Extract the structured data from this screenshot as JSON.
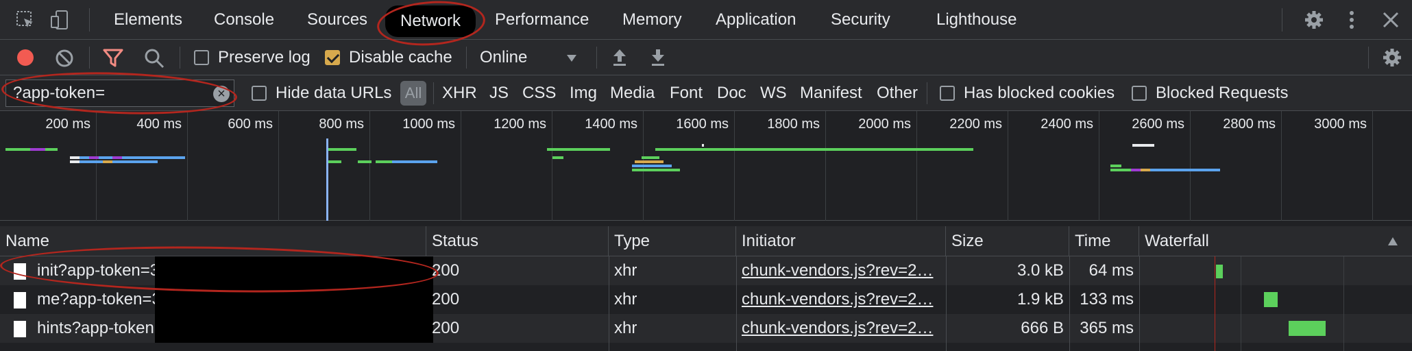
{
  "tabs": [
    "Elements",
    "Console",
    "Sources",
    "Network",
    "Performance",
    "Memory",
    "Application",
    "Security",
    "Lighthouse"
  ],
  "active_tab": "Network",
  "toolbar": {
    "preserve_log": "Preserve log",
    "disable_cache": "Disable cache",
    "throttling": "Online"
  },
  "filter": {
    "value": "?app-token=",
    "hide_data_urls": "Hide data URLs",
    "all": "All",
    "types": [
      "XHR",
      "JS",
      "CSS",
      "Img",
      "Media",
      "Font",
      "Doc",
      "WS",
      "Manifest",
      "Other"
    ],
    "has_blocked_cookies": "Has blocked cookies",
    "blocked_requests": "Blocked Requests"
  },
  "overview_ticks": [
    "200 ms",
    "400 ms",
    "600 ms",
    "800 ms",
    "1000 ms",
    "1200 ms",
    "1400 ms",
    "1600 ms",
    "1800 ms",
    "2000 ms",
    "2200 ms",
    "2400 ms",
    "2600 ms",
    "2800 ms",
    "3000 ms"
  ],
  "columns": {
    "name": "Name",
    "status": "Status",
    "type": "Type",
    "initiator": "Initiator",
    "size": "Size",
    "time": "Time",
    "waterfall": "Waterfall"
  },
  "rows": [
    {
      "name": "init?app-token=3",
      "status": "200",
      "type": "xhr",
      "initiator": "chunk-vendors.js?rev=2…",
      "size": "3.0 kB",
      "time": "64 ms"
    },
    {
      "name": "me?app-token=3",
      "status": "200",
      "type": "xhr",
      "initiator": "chunk-vendors.js?rev=2…",
      "size": "1.9 kB",
      "time": "133 ms"
    },
    {
      "name": "hints?app-token",
      "status": "200",
      "type": "xhr",
      "initiator": "chunk-vendors.js?rev=2…",
      "size": "666 B",
      "time": "365 ms"
    }
  ],
  "icons": [
    "inspect-element-icon",
    "device-toolbar-icon",
    "settings-gear-icon",
    "kebab-menu-icon",
    "close-icon",
    "record-icon",
    "clear-icon",
    "filter-icon",
    "search-icon",
    "dropdown-arrow-icon",
    "import-har-icon",
    "export-har-icon",
    "network-settings-icon",
    "file-icon",
    "sort-arrow-icon"
  ],
  "colors": {
    "record": "#f25b52",
    "filter_active": "#f28b82",
    "checkbox_checked": "#d7a94d",
    "bar_green": "#5cd05c",
    "bar_blue": "#5ba3ed",
    "bar_purple": "#9f3cd2",
    "annotation": "#b3261e"
  }
}
